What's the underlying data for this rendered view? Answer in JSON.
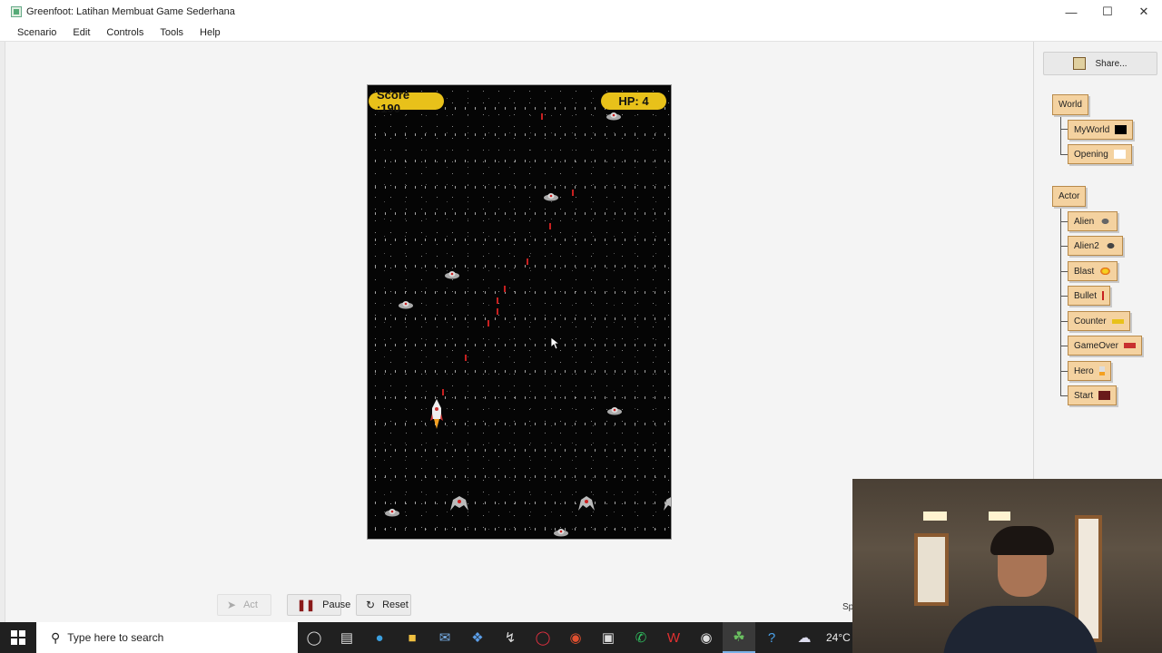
{
  "window": {
    "title": "Greenfoot: Latihan Membuat Game Sederhana"
  },
  "window_controls": {
    "minimize": "—",
    "maximize": "☐",
    "close": "✕"
  },
  "menu": [
    "Scenario",
    "Edit",
    "Controls",
    "Tools",
    "Help"
  ],
  "game": {
    "score_text": "Score :190",
    "hp_text": "HP: 4"
  },
  "controls": {
    "act": "Act",
    "pause": "Pause",
    "reset": "Reset",
    "speed_label": "Sp"
  },
  "sidebar": {
    "share": "Share...",
    "world_root": "World",
    "world_classes": [
      "MyWorld",
      "Opening"
    ],
    "actor_root": "Actor",
    "actor_classes": [
      "Alien",
      "Alien2",
      "Blast",
      "Bullet",
      "Counter",
      "GameOver",
      "Hero",
      "Start"
    ]
  },
  "taskbar": {
    "search_placeholder": "Type here to search",
    "weather": "24°C"
  },
  "colors": {
    "pill": "#e8c11a",
    "class_box": "#f4d2a0",
    "bullet": "#c82020"
  }
}
